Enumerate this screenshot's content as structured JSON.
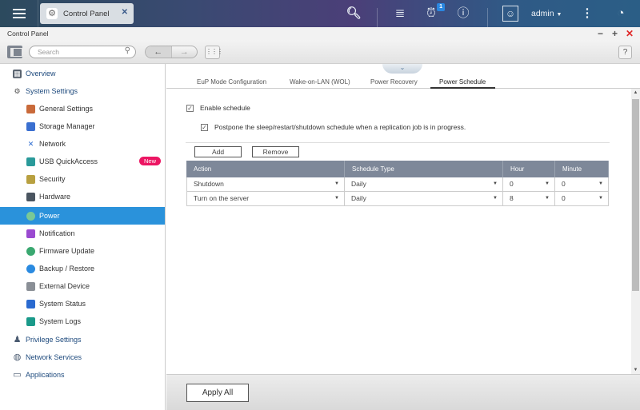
{
  "topbar": {
    "tab_title": "Control Panel",
    "badge_count": "1",
    "user": "admin",
    "icons": [
      "menu-icon",
      "search-icon",
      "task-stack-icon",
      "notification-icon",
      "info-icon",
      "user-icon",
      "more-icon",
      "dashboard-icon"
    ]
  },
  "window": {
    "title": "Control Panel",
    "search_placeholder": "Search",
    "help_label": "?"
  },
  "sidebar": {
    "items": [
      {
        "label": "Overview",
        "level": "top"
      },
      {
        "label": "System Settings",
        "level": "top"
      },
      {
        "label": "General Settings",
        "level": "sub"
      },
      {
        "label": "Storage Manager",
        "level": "sub"
      },
      {
        "label": "Network",
        "level": "sub"
      },
      {
        "label": "USB QuickAccess",
        "level": "sub",
        "badge": "New"
      },
      {
        "label": "Security",
        "level": "sub"
      },
      {
        "label": "Hardware",
        "level": "sub"
      },
      {
        "label": "Power",
        "level": "sub",
        "active": true
      },
      {
        "label": "Notification",
        "level": "sub"
      },
      {
        "label": "Firmware Update",
        "level": "sub"
      },
      {
        "label": "Backup / Restore",
        "level": "sub"
      },
      {
        "label": "External Device",
        "level": "sub"
      },
      {
        "label": "System Status",
        "level": "sub"
      },
      {
        "label": "System Logs",
        "level": "sub"
      },
      {
        "label": "Privilege Settings",
        "level": "top"
      },
      {
        "label": "Network Services",
        "level": "top"
      },
      {
        "label": "Applications",
        "level": "top"
      }
    ]
  },
  "tabs": [
    {
      "label": "EuP Mode Configuration"
    },
    {
      "label": "Wake-on-LAN (WOL)"
    },
    {
      "label": "Power Recovery"
    },
    {
      "label": "Power Schedule",
      "active": true
    }
  ],
  "schedule": {
    "enable_label": "Enable schedule",
    "enable_checked": true,
    "postpone_label": "Postpone the sleep/restart/shutdown schedule when a replication job is in progress.",
    "postpone_checked": true,
    "add_label": "Add",
    "remove_label": "Remove",
    "columns": [
      "Action",
      "Schedule Type",
      "Hour",
      "Minute"
    ],
    "rows": [
      {
        "action": "Shutdown",
        "type": "Daily",
        "hour": "0",
        "minute": "0"
      },
      {
        "action": "Turn on the server",
        "type": "Daily",
        "hour": "8",
        "minute": "0"
      }
    ]
  },
  "footer": {
    "apply_label": "Apply All"
  },
  "colors": {
    "accent": "#2a92db",
    "new_badge": "#ec1663",
    "grid_header": "#7e8899"
  }
}
